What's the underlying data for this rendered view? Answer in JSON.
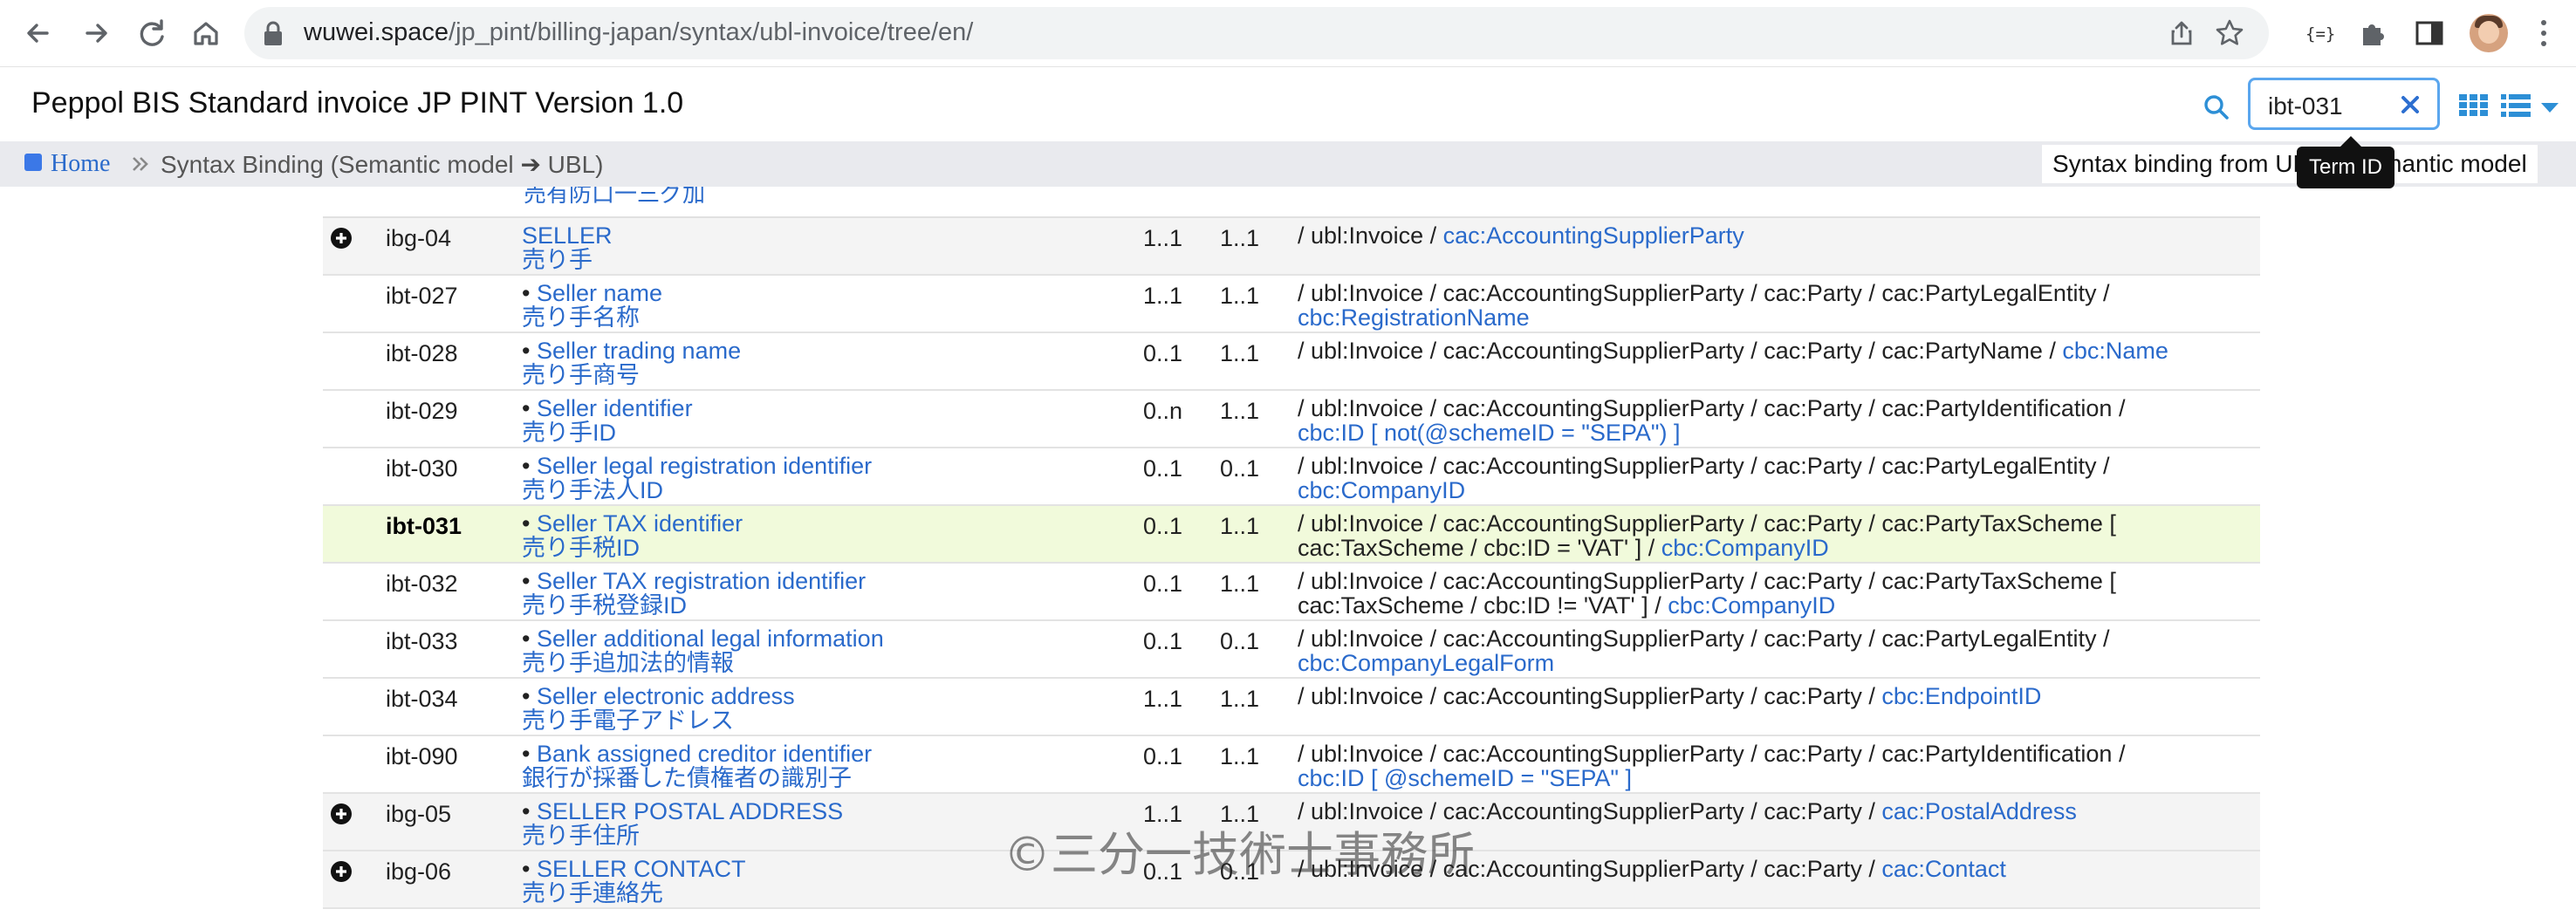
{
  "browser": {
    "url_host": "wuwei.space",
    "url_path": "/jp_pint/billing-japan/syntax/ubl-invoice/tree/en/"
  },
  "header": {
    "title": "Peppol BIS Standard invoice JP PINT Version 1.0",
    "search_value": "ibt-031"
  },
  "breadcrumb": {
    "home": "Home",
    "current_part1": "Syntax Binding (Semantic model ",
    "arrow": "➔",
    "current_part2": " UBL)",
    "right_info": "Syntax binding from UBL to semantic model"
  },
  "tooltip": "Term ID",
  "table": {
    "partial_top_text": "売有防口一三グ加",
    "rows": [
      {
        "id": "ibg-04",
        "en": "SELLER",
        "ja": "売り手",
        "bullet": "",
        "card1": "1..1",
        "card2": "1..1",
        "path1": "/ ubl:Invoice / ",
        "path1_link": "cac:AccountingSupplierParty",
        "path2": "",
        "path2_link": ""
      },
      {
        "id": "ibt-027",
        "en": "Seller name",
        "ja": "売り手名称",
        "bullet": "•",
        "card1": "1..1",
        "card2": "1..1",
        "path1": "/ ubl:Invoice / cac:AccountingSupplierParty / cac:Party / cac:PartyLegalEntity /",
        "path1_link": "",
        "path2": "",
        "path2_link": "cbc:RegistrationName"
      },
      {
        "id": "ibt-028",
        "en": "Seller trading name",
        "ja": "売り手商号",
        "bullet": "•",
        "card1": "0..1",
        "card2": "1..1",
        "path1": "/ ubl:Invoice / cac:AccountingSupplierParty / cac:Party / cac:PartyName / ",
        "path1_link": "cbc:Name",
        "path2": "",
        "path2_link": ""
      },
      {
        "id": "ibt-029",
        "en": "Seller identifier",
        "ja": "売り手ID",
        "bullet": "•",
        "card1": "0..n",
        "card2": "1..1",
        "path1": "/ ubl:Invoice / cac:AccountingSupplierParty / cac:Party / cac:PartyIdentification /",
        "path1_link": "",
        "path2": "",
        "path2_link": "cbc:ID [ not(@schemeID = \"SEPA\") ]"
      },
      {
        "id": "ibt-030",
        "en": "Seller legal registration identifier",
        "ja": "売り手法人ID",
        "bullet": "•",
        "card1": "0..1",
        "card2": "0..1",
        "path1": "/ ubl:Invoice / cac:AccountingSupplierParty / cac:Party / cac:PartyLegalEntity /",
        "path1_link": "",
        "path2": "",
        "path2_link": "cbc:CompanyID"
      },
      {
        "id": "ibt-031",
        "en": "Seller TAX identifier",
        "ja": "売り手税ID",
        "bullet": "•",
        "card1": "0..1",
        "card2": "1..1",
        "path1": "/ ubl:Invoice / cac:AccountingSupplierParty / cac:Party / cac:PartyTaxScheme [",
        "path1_link": "",
        "path2": "cac:TaxScheme / cbc:ID = 'VAT' ] / ",
        "path2_link": "cbc:CompanyID"
      },
      {
        "id": "ibt-032",
        "en": "Seller TAX registration identifier",
        "ja": "売り手税登録ID",
        "bullet": "•",
        "card1": "0..1",
        "card2": "1..1",
        "path1": "/ ubl:Invoice / cac:AccountingSupplierParty / cac:Party / cac:PartyTaxScheme [",
        "path1_link": "",
        "path2": "cac:TaxScheme / cbc:ID != 'VAT' ] / ",
        "path2_link": "cbc:CompanyID"
      },
      {
        "id": "ibt-033",
        "en": "Seller additional legal information",
        "ja": "売り手追加法的情報",
        "bullet": "•",
        "card1": "0..1",
        "card2": "0..1",
        "path1": "/ ubl:Invoice / cac:AccountingSupplierParty / cac:Party / cac:PartyLegalEntity /",
        "path1_link": "",
        "path2": "",
        "path2_link": "cbc:CompanyLegalForm"
      },
      {
        "id": "ibt-034",
        "en": "Seller electronic address",
        "ja": "売り手電子アドレス",
        "bullet": "•",
        "card1": "1..1",
        "card2": "1..1",
        "path1": "/ ubl:Invoice / cac:AccountingSupplierParty / cac:Party / ",
        "path1_link": "cbc:EndpointID",
        "path2": "",
        "path2_link": ""
      },
      {
        "id": "ibt-090",
        "en": "Bank assigned creditor identifier",
        "ja": "銀行が採番した債権者の識別子",
        "bullet": "•",
        "card1": "0..1",
        "card2": "1..1",
        "path1": "/ ubl:Invoice / cac:AccountingSupplierParty / cac:Party / cac:PartyIdentification /",
        "path1_link": "",
        "path2": "",
        "path2_link": "cbc:ID [ @schemeID = \"SEPA\" ]"
      },
      {
        "id": "ibg-05",
        "en": "SELLER POSTAL ADDRESS",
        "ja": "売り手住所",
        "bullet": "•",
        "card1": "1..1",
        "card2": "1..1",
        "path1": "/ ubl:Invoice / cac:AccountingSupplierParty / cac:Party / ",
        "path1_link": "cac:PostalAddress",
        "path2": "",
        "path2_link": ""
      },
      {
        "id": "ibg-06",
        "en": "SELLER CONTACT",
        "ja": "売り手連絡先",
        "bullet": "•",
        "card1": "0..1",
        "card2": "0..1",
        "path1": "/ ubl:Invoice / cac:AccountingSupplierParty / cac:Party / ",
        "path1_link": "cac:Contact",
        "path2": "",
        "path2_link": ""
      }
    ]
  },
  "watermark": "©三分一技術士事務所"
}
